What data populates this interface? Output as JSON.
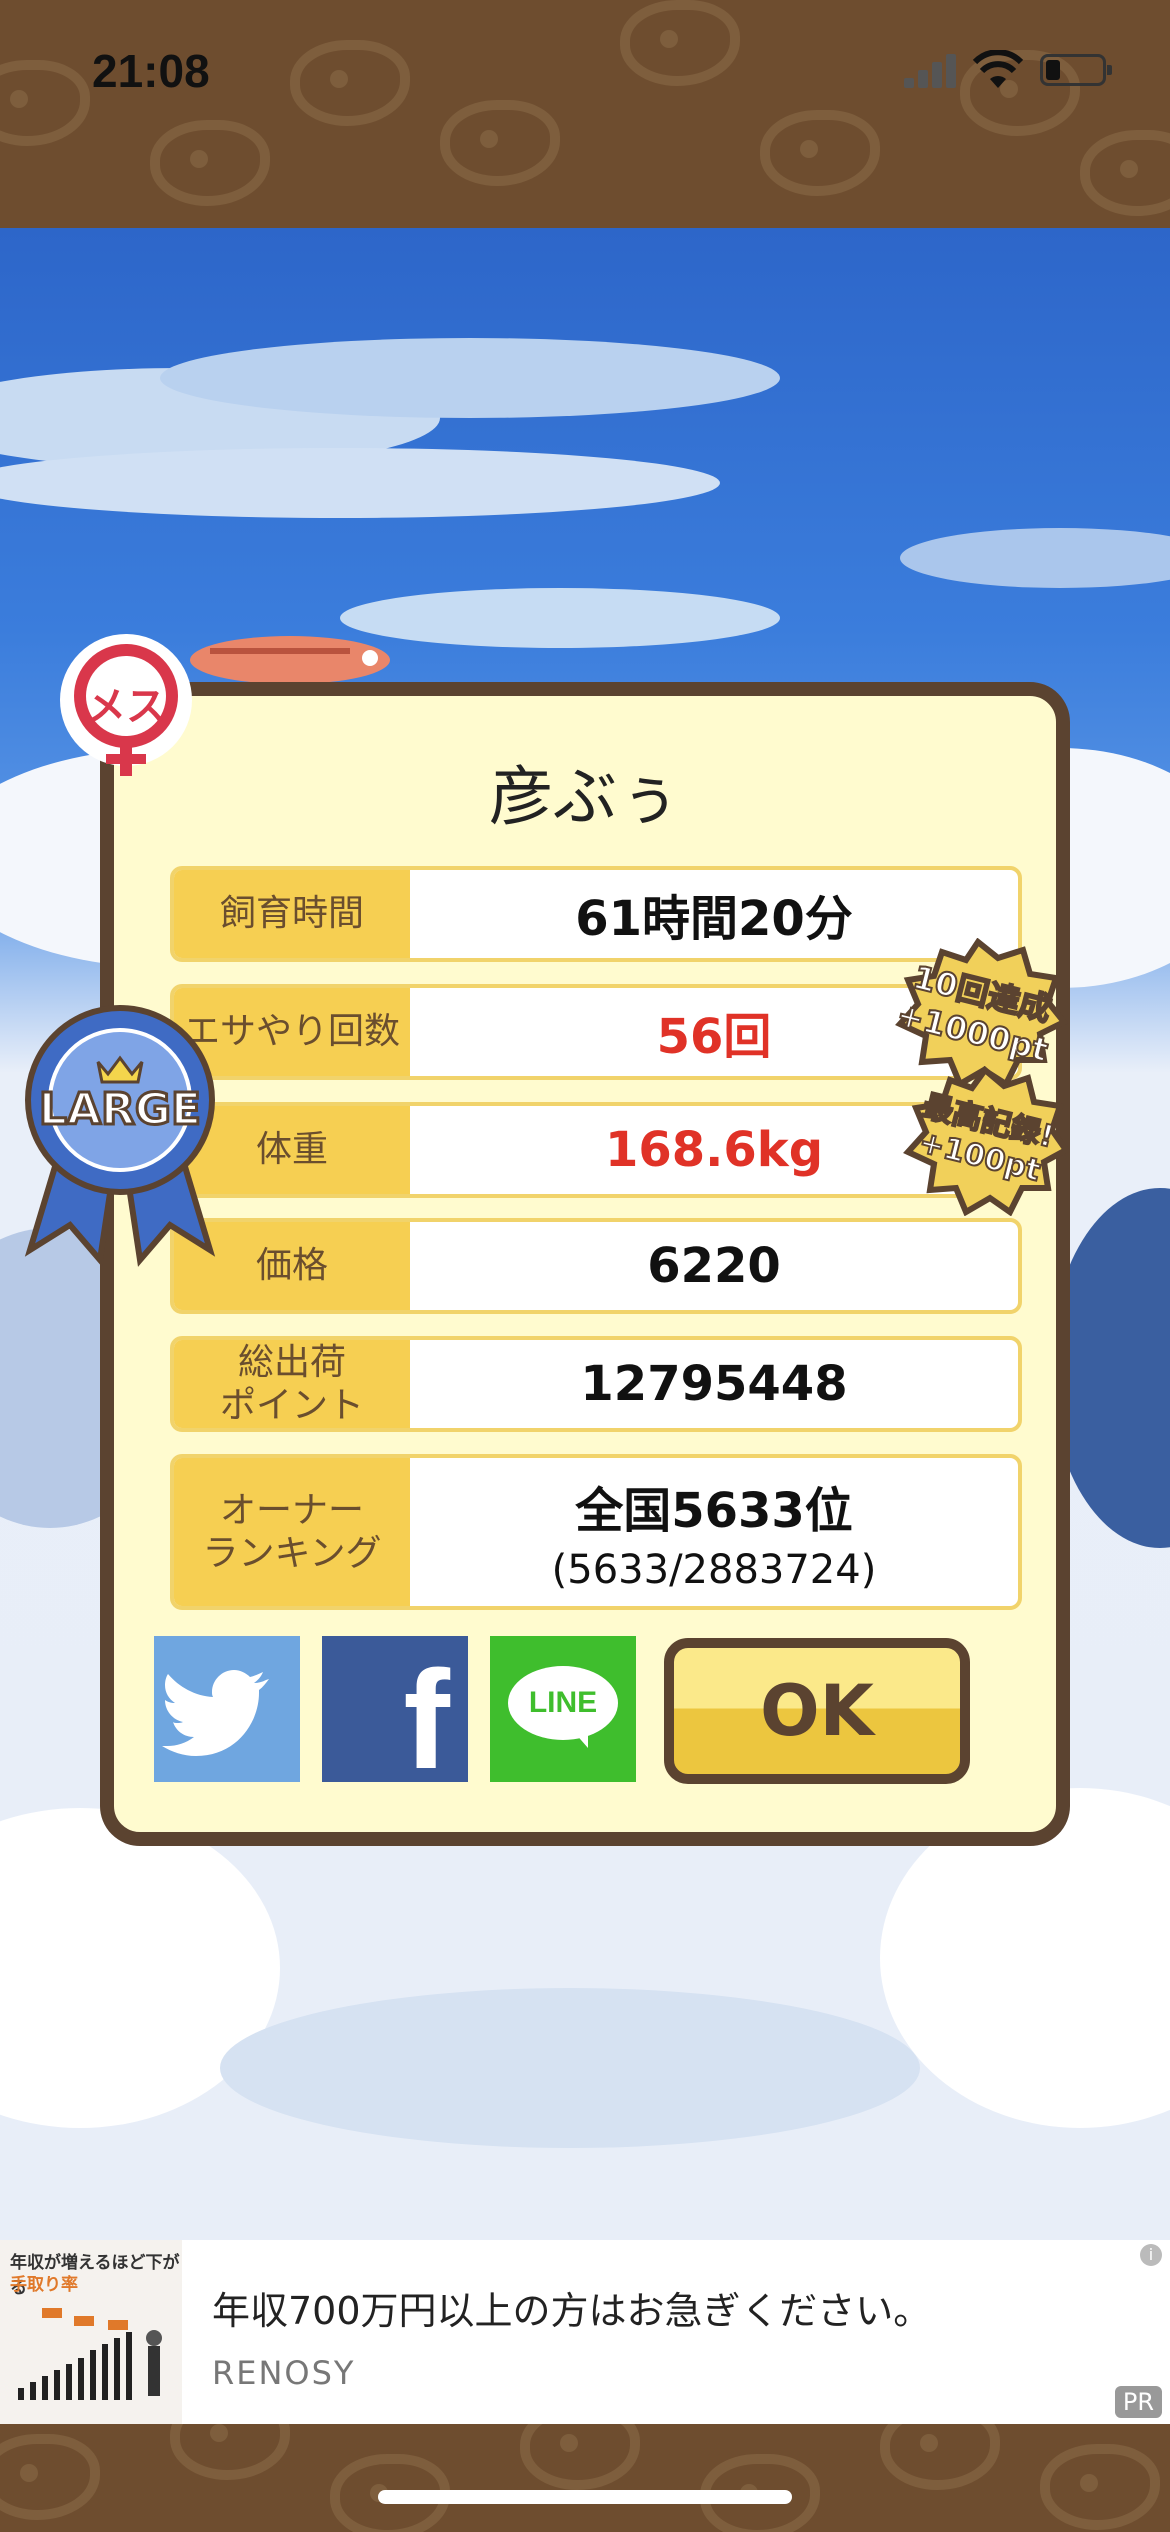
{
  "status_bar": {
    "time": "21:08"
  },
  "dialog": {
    "pet_name": "彦ぶぅ",
    "rows": [
      {
        "label": "飼育時間",
        "value": "61時間20分"
      },
      {
        "label": "エサやり回数",
        "value": "56回"
      },
      {
        "label": "体重",
        "value": "168.6kg"
      },
      {
        "label": "価格",
        "value": "6220"
      },
      {
        "label": "総出荷\nポイント",
        "value": "12795448"
      },
      {
        "label": "オーナー\nランキング",
        "value": "全国5633位",
        "sub": "(5633/2883724)"
      }
    ],
    "ok_label": "OK",
    "female_badge": "メス",
    "size_badge": "LARGE",
    "stamp_1": [
      "10回達成",
      "+1000pt"
    ],
    "stamp_2": [
      "最高記録!",
      "+100pt"
    ],
    "social": {
      "facebook": "f",
      "line": "LINE"
    }
  },
  "ad": {
    "title": "年収700万円以上の方はお急ぎください。",
    "source": "RENOSY",
    "pr": "PR",
    "info": "i",
    "thumb_heading": "年収が増えるほど下がる",
    "thumb_heading2": "手取り率"
  },
  "colors": {
    "label_bg": "#f6cf52",
    "highlight_red": "#e03227",
    "frame_brown": "#5b4330"
  }
}
